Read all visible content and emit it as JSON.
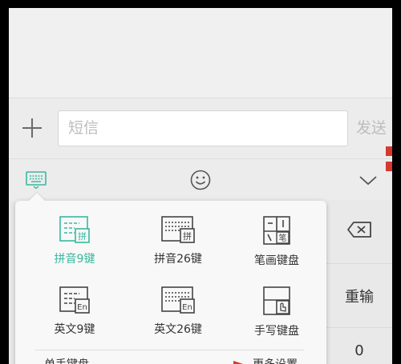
{
  "compose": {
    "input_placeholder": "短信",
    "send_label": "发送"
  },
  "toolbar": {
    "keyboard_icon": "keyboard-icon",
    "emoji_icon": "smiley-icon",
    "collapse_icon": "chevron-down-icon"
  },
  "keyboard_menu": {
    "options": [
      {
        "label": "拼音9键",
        "icon": "pinyin-9-icon",
        "selected": true
      },
      {
        "label": "拼音26键",
        "icon": "pinyin-26-icon",
        "selected": false
      },
      {
        "label": "笔画键盘",
        "icon": "stroke-keyboard-icon",
        "selected": false
      },
      {
        "label": "英文9键",
        "icon": "english-9-icon",
        "selected": false
      },
      {
        "label": "英文26键",
        "icon": "english-26-icon",
        "selected": false
      },
      {
        "label": "手写键盘",
        "icon": "handwriting-icon",
        "selected": false
      }
    ],
    "single_hand_label": "单手键盘",
    "more_settings_label": "更多设置"
  },
  "side_keys": {
    "delete_icon": "backspace-icon",
    "redo_label": "重输",
    "zero_label": "0"
  },
  "colors": {
    "accent": "#3ab79f",
    "icon_gray": "#555555",
    "annotation_red": "#d43a2f"
  }
}
